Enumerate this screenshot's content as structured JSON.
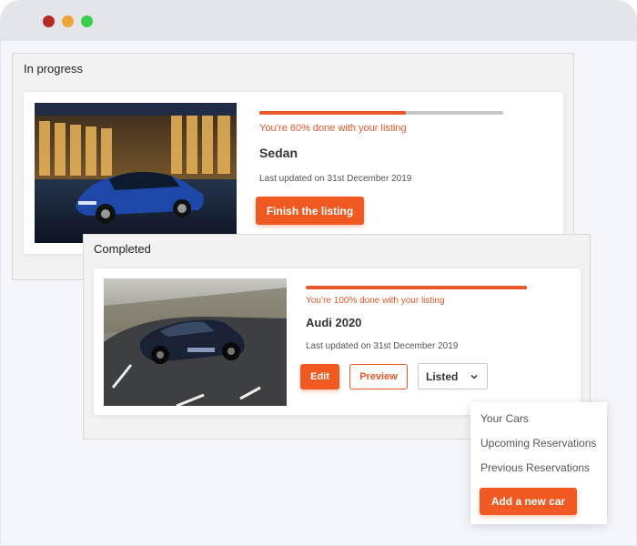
{
  "in_progress": {
    "title": "In progress",
    "progress_percent": 60,
    "status": "You’re 60% done with your listing",
    "car_name": "Sedan",
    "updated": "Last updated on 31st December 2019",
    "finish_button": "Finish the listing"
  },
  "completed": {
    "title": "Completed",
    "progress_percent": 100,
    "status": "You’re 100% done with your listing",
    "car_name": "Audi 2020",
    "updated": "Last updated on 31st December 2019",
    "edit_button": "Edit",
    "preview_button": "Preview",
    "status_select": "Listed"
  },
  "menu": {
    "items": [
      "Your Cars",
      "Upcoming Reservations",
      "Previous Reservations"
    ],
    "add_button": "Add a new car"
  },
  "colors": {
    "accent": "#f05a22",
    "window_red": "#b32b22",
    "window_yellow": "#eba636",
    "window_green": "#3ccc4a"
  }
}
